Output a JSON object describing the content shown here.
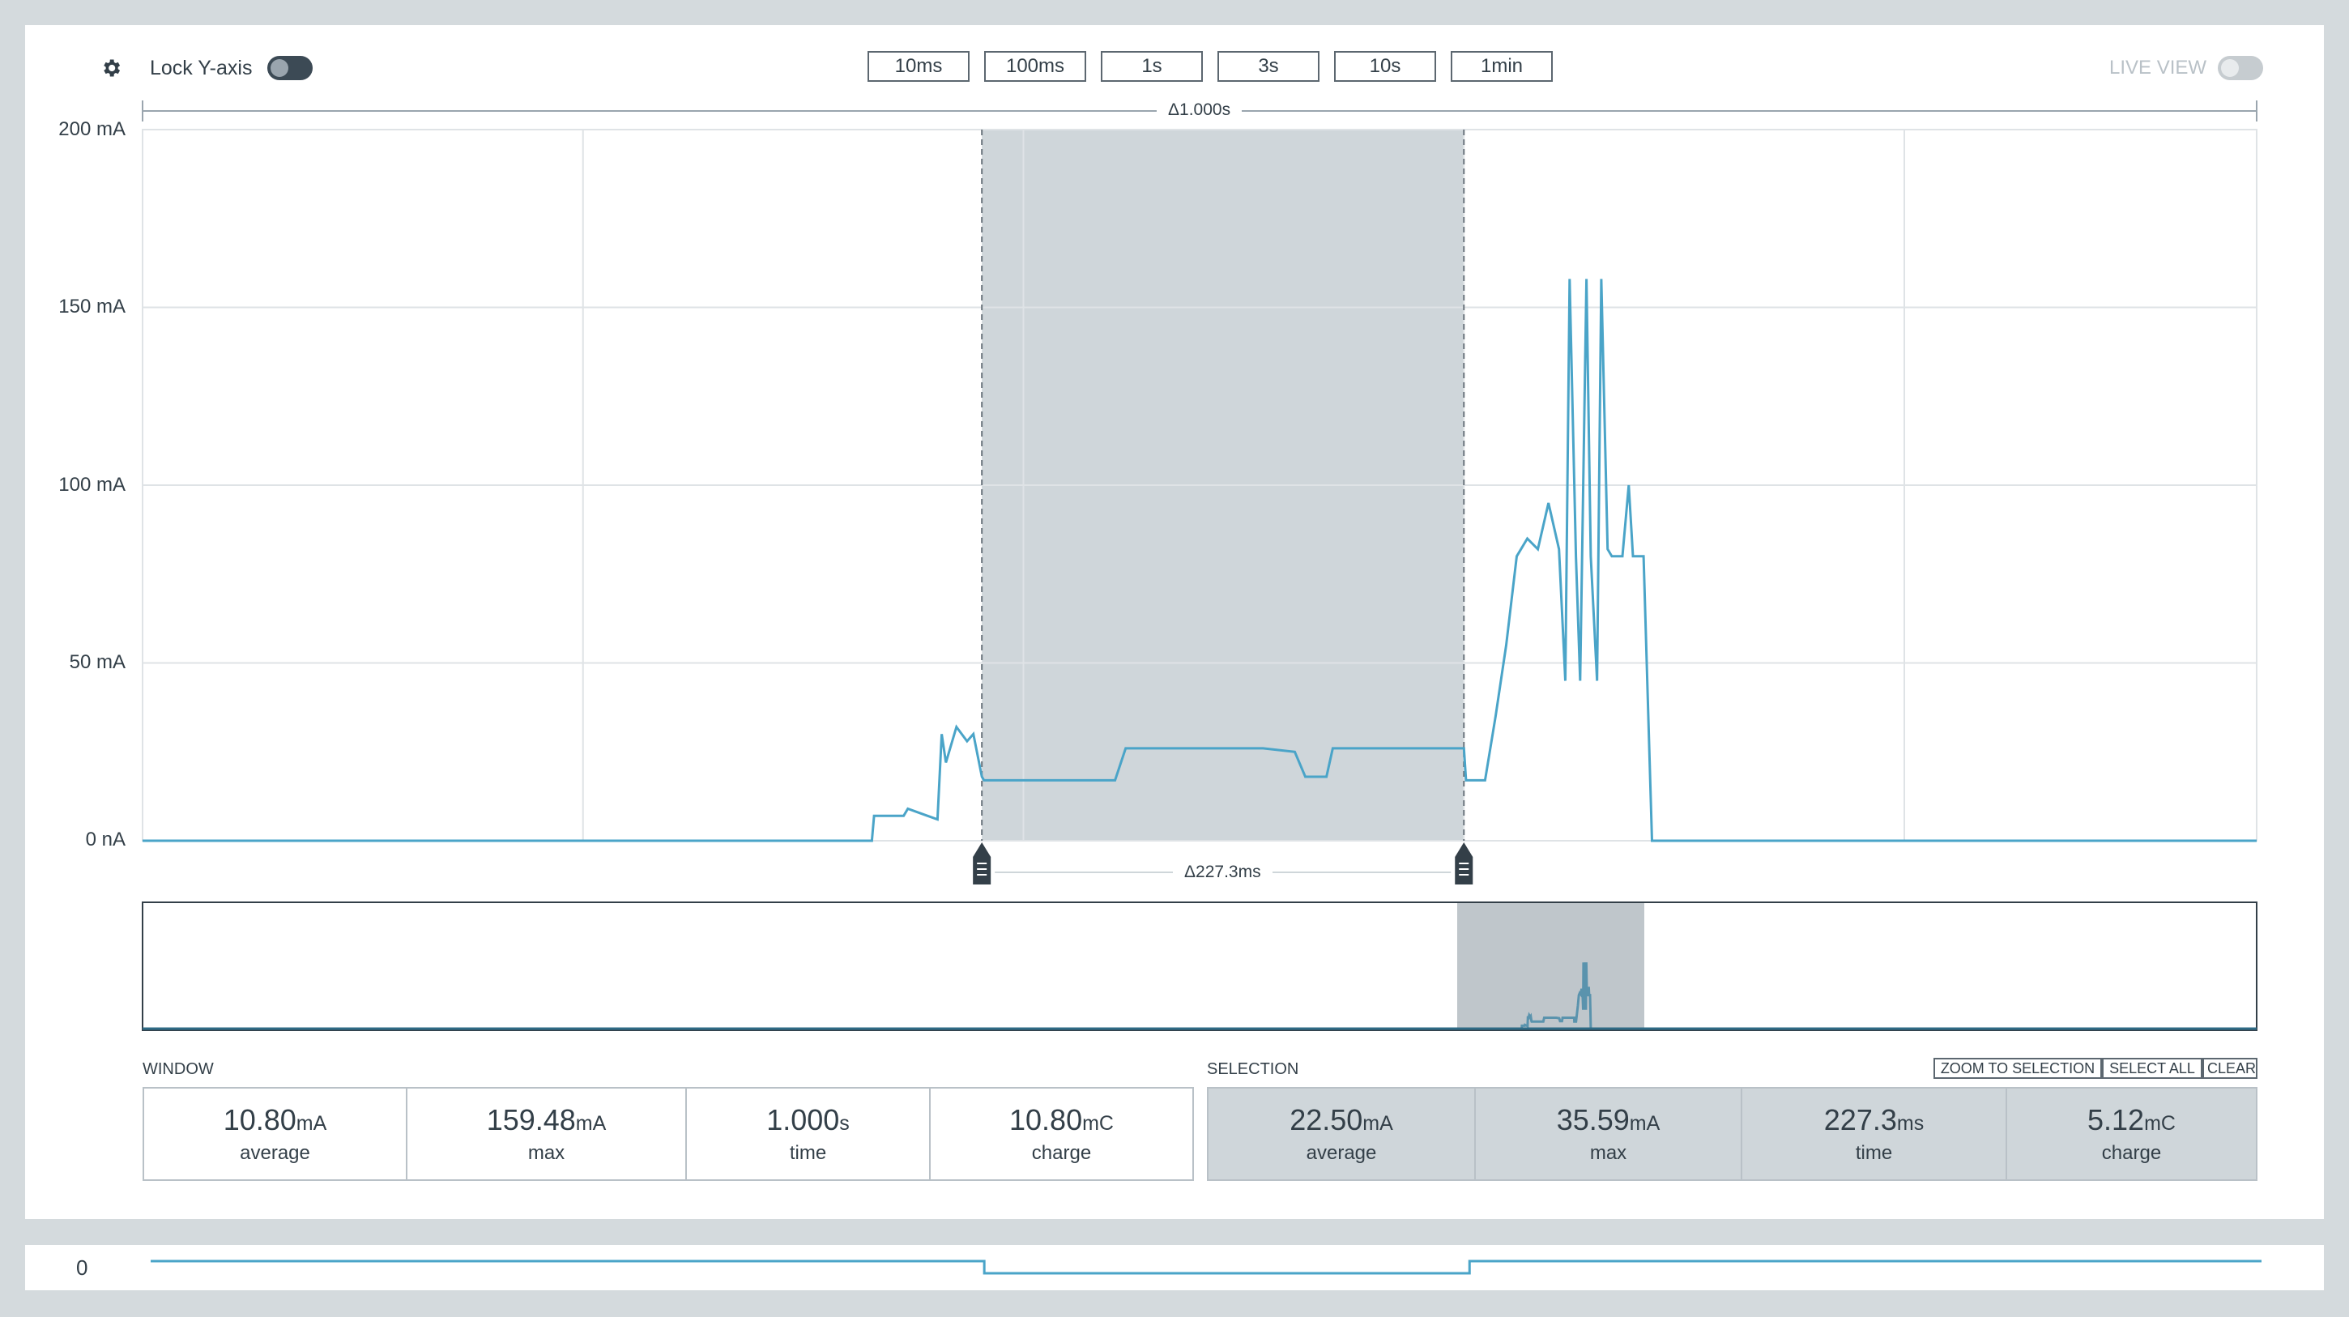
{
  "toolbar": {
    "settings_icon": "gear-icon",
    "lock_label": "Lock Y-axis",
    "lock_on": true,
    "time_buttons": [
      "10ms",
      "100ms",
      "1s",
      "3s",
      "10s",
      "1min"
    ],
    "live_label": "LIVE VIEW",
    "live_on": false
  },
  "chart": {
    "window_delta": "Δ1.000s",
    "selection_delta": "Δ227.3ms",
    "line_color": "#4aa4c8",
    "selection_color": "#cfd6da"
  },
  "chart_data": {
    "type": "line",
    "x_unit": "s",
    "xlim": [
      0,
      1.0
    ],
    "ylim": [
      0,
      200
    ],
    "y_ticks": [
      "200 mA",
      "150 mA",
      "100 mA",
      "50 mA",
      "0 nA"
    ],
    "y_tick_values": [
      200,
      150,
      100,
      50,
      0
    ],
    "selection_range": [
      0.397,
      0.625
    ],
    "series": [
      {
        "values_x": [
          0,
          0.345,
          0.346,
          0.36,
          0.362,
          0.376,
          0.378,
          0.38,
          0.385,
          0.39,
          0.393,
          0.397,
          0.398,
          0.43,
          0.46,
          0.465,
          0.53,
          0.545,
          0.55,
          0.56,
          0.563,
          0.62,
          0.625,
          0.626,
          0.635,
          0.64,
          0.645,
          0.65,
          0.655,
          0.66,
          0.665,
          0.67,
          0.673,
          0.675,
          0.678,
          0.68,
          0.683,
          0.685,
          0.688,
          0.69,
          0.693,
          0.695,
          0.7,
          0.703,
          0.705,
          0.71,
          0.712,
          0.714,
          0.716,
          0.72,
          1.0
        ],
        "values_y": [
          0,
          0,
          7,
          7,
          9,
          6,
          30,
          22,
          32,
          28,
          30,
          18,
          17,
          17,
          17,
          26,
          26,
          25,
          18,
          18,
          26,
          26,
          26,
          17,
          17,
          35,
          55,
          80,
          85,
          82,
          95,
          82,
          45,
          158,
          80,
          45,
          158,
          80,
          45,
          158,
          82,
          80,
          80,
          100,
          80,
          80,
          40,
          0,
          0,
          0,
          0
        ]
      }
    ]
  },
  "overview": {
    "window_fill": "#bfc6cb"
  },
  "window": {
    "label": "WINDOW",
    "stats": [
      {
        "value": "10.80",
        "unit": "mA",
        "label": "average"
      },
      {
        "value": "159.48",
        "unit": "mA",
        "label": "max"
      },
      {
        "value": "1.000",
        "unit": "s",
        "label": "time"
      },
      {
        "value": "10.80",
        "unit": "mC",
        "label": "charge"
      }
    ]
  },
  "selection": {
    "label": "SELECTION",
    "buttons": [
      "ZOOM TO SELECTION",
      "SELECT ALL",
      "CLEAR"
    ],
    "stats": [
      {
        "value": "22.50",
        "unit": "mA",
        "label": "average"
      },
      {
        "value": "35.59",
        "unit": "mA",
        "label": "max"
      },
      {
        "value": "227.3",
        "unit": "ms",
        "label": "time"
      },
      {
        "value": "5.12",
        "unit": "mC",
        "label": "charge"
      }
    ]
  },
  "digital": {
    "channel_label": "0"
  }
}
